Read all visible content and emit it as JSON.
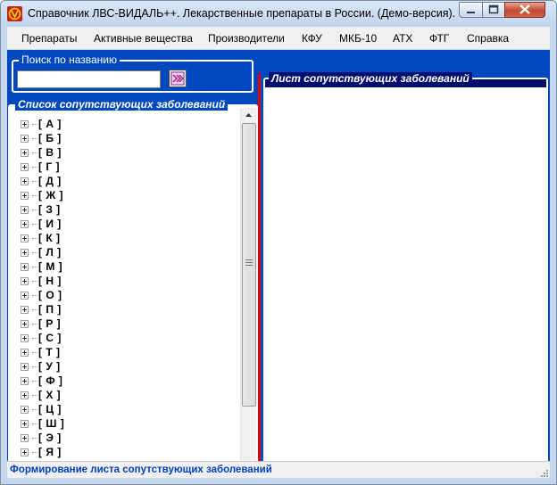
{
  "window": {
    "title": "Справочник ЛВС-ВИДАЛЬ++. Лекарственные препараты в России. (Демо-версия)."
  },
  "menu": {
    "items": [
      "Препараты",
      "Активные вещества",
      "Производители",
      "КФУ",
      "МКБ-10",
      "АТХ",
      "ФТГ",
      "Справка"
    ]
  },
  "search": {
    "legend": "Поиск по названию",
    "value": ""
  },
  "list": {
    "legend": "Список сопутствующих заболеваний",
    "items": [
      "[ А ]",
      "[ Б ]",
      "[ В ]",
      "[ Г ]",
      "[ Д ]",
      "[ Ж ]",
      "[ З ]",
      "[ И ]",
      "[ К ]",
      "[ Л ]",
      "[ М ]",
      "[ Н ]",
      "[ О ]",
      "[ П ]",
      "[ Р ]",
      "[ С ]",
      "[ Т ]",
      "[ У ]",
      "[ Ф ]",
      "[ Х ]",
      "[ Ц ]",
      "[ Ш ]",
      "[ Э ]",
      "[ Я ]"
    ]
  },
  "sheet": {
    "legend": "Лист сопутствующих заболеваний"
  },
  "status": {
    "text": "Формирование листа сопутствующих заболеваний"
  },
  "icons": {
    "app": "app-logo-icon",
    "search_button": "search-go-icon",
    "expander": "plus-expander-icon"
  },
  "colors": {
    "panel_blue": "#0048bf",
    "navy": "#000f6e",
    "splitter_red": "#e00000",
    "status_text": "#0040c0"
  }
}
